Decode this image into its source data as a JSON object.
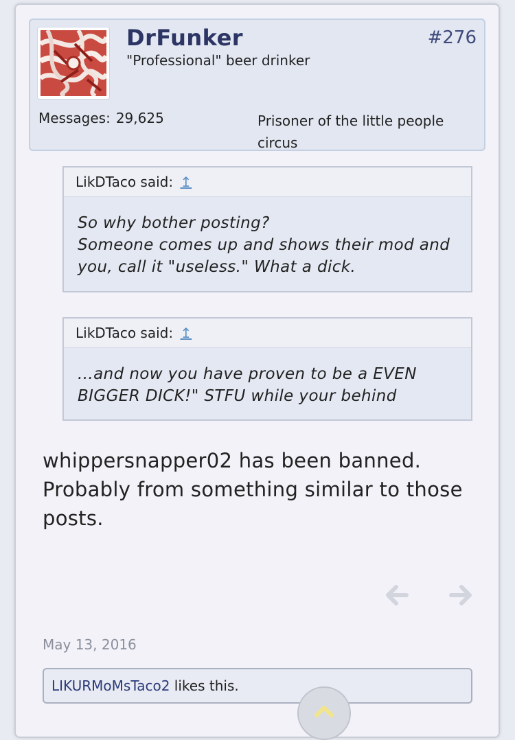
{
  "post": {
    "username": "DrFunker",
    "user_title": "\"Professional\" beer drinker",
    "post_number": "#276",
    "messages_label": "Messages:",
    "messages_count": "29,625",
    "custom_title": "Prisoner of the little people circus"
  },
  "quotes": [
    {
      "author": "LikDTaco said:",
      "jump_icon": "↥",
      "lines": [
        "So why bother posting?",
        "Someone comes up and shows their mod and you, call it \"useless.\" What a dick."
      ]
    },
    {
      "author": "LikDTaco said:",
      "jump_icon": "↥",
      "lines": [
        "...and now you have proven to be a EVEN BIGGER DICK!\" STFU while your behind"
      ]
    }
  ],
  "message": "whippersnapper02 has been banned. Probably from something similar to those posts.",
  "date": "May 13, 2016",
  "likes": {
    "user": "LIKURMoMsTaco2",
    "suffix": " likes this."
  },
  "icons": {
    "prev": "arrow-left-icon",
    "next": "arrow-right-icon",
    "scroll": "chevron-up-icon"
  },
  "colors": {
    "username": "#2c3563",
    "link": "#5a8ec4",
    "scroll_chevron": "#f2e48a"
  }
}
